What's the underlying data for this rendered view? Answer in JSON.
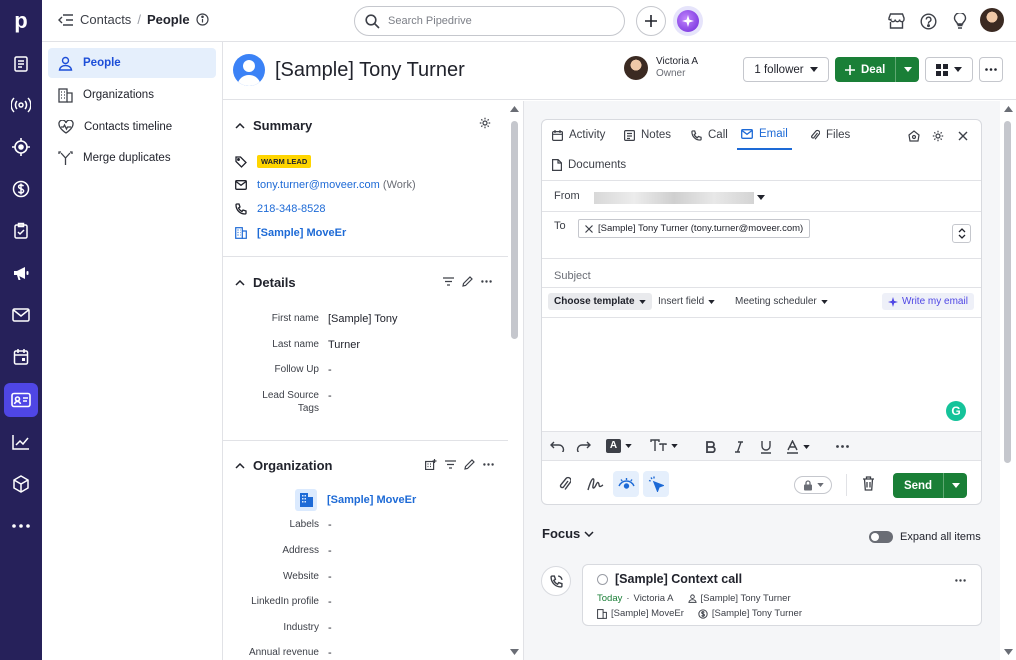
{
  "app": {
    "logo": "p"
  },
  "topbar": {
    "breadcrumb_parent": "Contacts",
    "breadcrumb_sep": "/",
    "breadcrumb_current": "People",
    "search_placeholder": "Search Pipedrive"
  },
  "sidebar": {
    "items": [
      {
        "label": "People",
        "icon": "person-icon",
        "active": true
      },
      {
        "label": "Organizations",
        "icon": "building-icon"
      },
      {
        "label": "Contacts timeline",
        "icon": "heart-icon"
      },
      {
        "label": "Merge duplicates",
        "icon": "merge-icon"
      }
    ]
  },
  "person": {
    "name": "[Sample] Tony Turner",
    "owner_name": "Victoria A",
    "owner_role": "Owner",
    "follower_label": "1 follower",
    "deal_label": "Deal"
  },
  "summary": {
    "title": "Summary",
    "badge": "WARM LEAD",
    "email": "tony.turner@moveer.com",
    "email_type": "(Work)",
    "phone": "218-348-8528",
    "org": "[Sample] MoveEr"
  },
  "details": {
    "title": "Details",
    "fields": [
      {
        "label": "First name",
        "value": "[Sample] Tony"
      },
      {
        "label": "Last name",
        "value": "Turner"
      },
      {
        "label": "Follow Up",
        "value": "-"
      },
      {
        "label": "Lead Source",
        "label2": "Tags",
        "value": "-"
      }
    ]
  },
  "organization": {
    "title": "Organization",
    "name": "[Sample] MoveEr",
    "fields": [
      {
        "label": "Labels",
        "value": "-"
      },
      {
        "label": "Address",
        "value": "-"
      },
      {
        "label": "Website",
        "value": "-"
      },
      {
        "label": "LinkedIn profile",
        "value": "-"
      },
      {
        "label": "Industry",
        "value": "-"
      },
      {
        "label": "Annual revenue",
        "value": "-"
      }
    ]
  },
  "composer": {
    "tabs": [
      "Activity",
      "Notes",
      "Call",
      "Email",
      "Files",
      "Documents"
    ],
    "active_tab": "Email",
    "from_label": "From",
    "to_label": "To",
    "to_chip": "[Sample] Tony Turner (tony.turner@moveer.com)",
    "subject_placeholder": "Subject",
    "toolbar": {
      "choose_template": "Choose template",
      "insert_field": "Insert field",
      "meeting_scheduler": "Meeting scheduler",
      "write_my_email": "Write my email"
    },
    "send_label": "Send"
  },
  "focus": {
    "title": "Focus",
    "expand_label": "Expand all items",
    "activity": {
      "title": "[Sample] Context call",
      "date": "Today",
      "owner": "Victoria A",
      "person": "[Sample] Tony Turner",
      "org": "[Sample] MoveEr",
      "deal": "[Sample] Tony Turner"
    }
  },
  "colors": {
    "rail": "#26215a",
    "accent": "#1d6ad6",
    "green": "#1a7f37",
    "badge": "#ffd500"
  }
}
